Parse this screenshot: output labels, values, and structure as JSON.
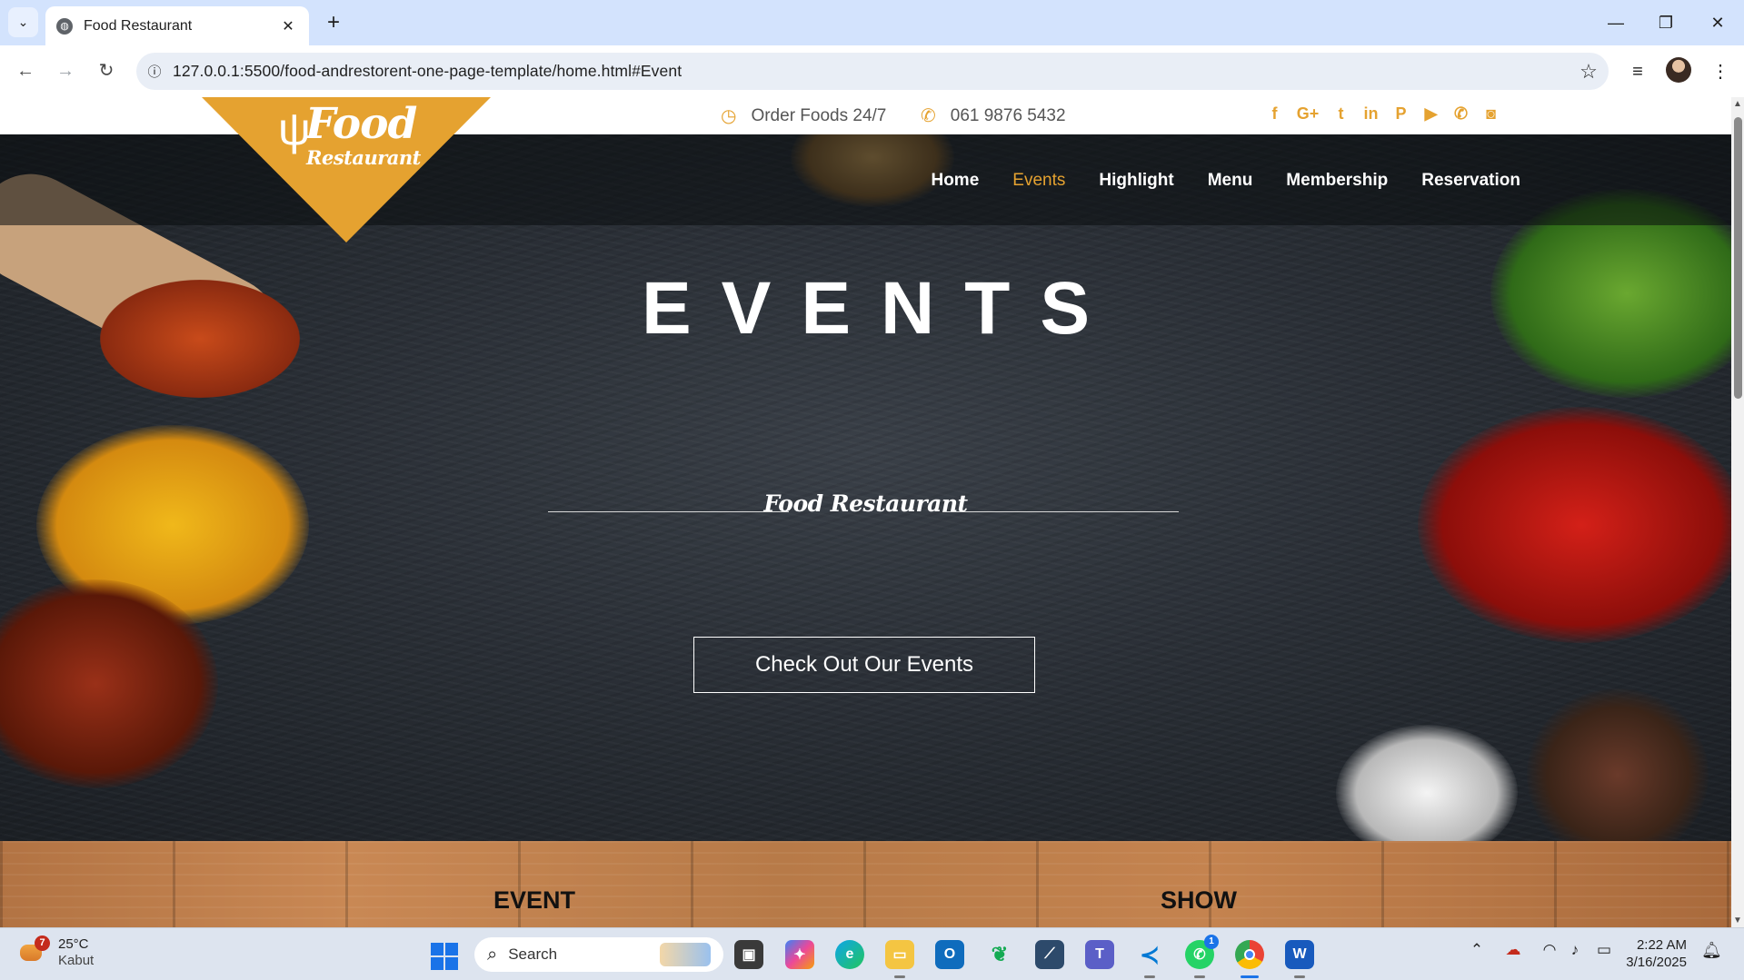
{
  "browser": {
    "tab_title": "Food Restaurant",
    "tab_list_icon": "chevron-down-icon",
    "close_tab_glyph": "✕",
    "new_tab_glyph": "+",
    "url": "127.0.0.1:5500/food-andrestorent-one-page-template/home.html#Event",
    "window": {
      "minimize": "—",
      "maximize": "❐",
      "close": "✕"
    }
  },
  "topbar": {
    "order_text": "Order Foods 24/7",
    "phone": "061 9876 5432",
    "accent_color": "#e5a230",
    "social_icons": [
      "facebook-icon",
      "google-plus-icon",
      "twitter-icon",
      "linkedin-icon",
      "pinterest-icon",
      "youtube-icon",
      "phone-icon",
      "instagram-icon"
    ],
    "social_glyphs": [
      "f",
      "G+",
      "t",
      "in",
      "P",
      "▶",
      "✆",
      "◙"
    ]
  },
  "logo": {
    "line1": "Food",
    "line2": "Restaurant"
  },
  "nav": {
    "items": [
      "Home",
      "Events",
      "Highlight",
      "Menu",
      "Membership",
      "Reservation"
    ],
    "active": "Events"
  },
  "hero": {
    "title": "EVENTS",
    "subtitle": "Food Restaurant",
    "button": "Check Out Our Events"
  },
  "section": {
    "col1": "EVENT",
    "col2": "SHOW"
  },
  "taskbar": {
    "weather_badge": "7",
    "temperature": "25°C",
    "condition": "Kabut",
    "search_placeholder": "Search",
    "whatsapp_badge": "1",
    "time": "2:22 AM",
    "date": "3/16/2025"
  }
}
